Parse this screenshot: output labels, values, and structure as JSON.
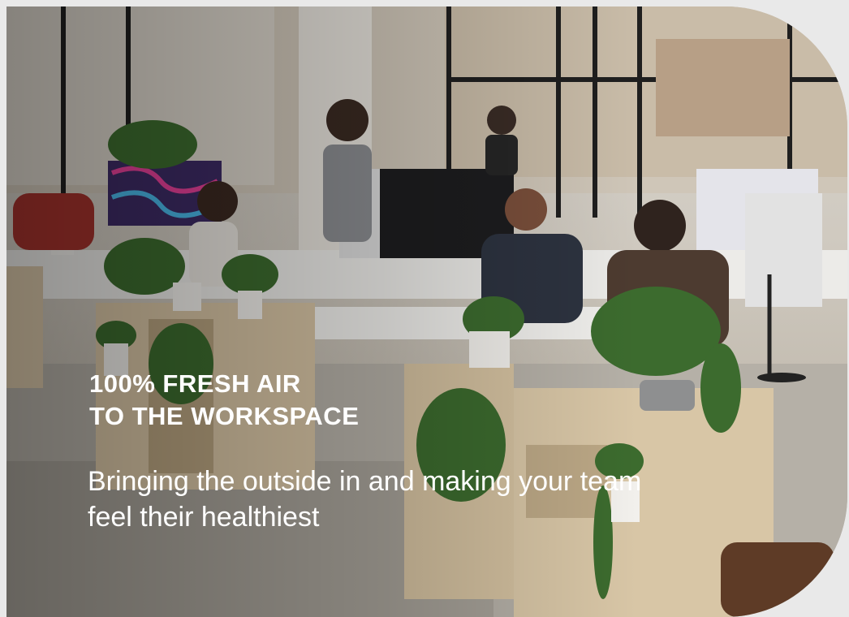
{
  "hero": {
    "image_description": "office-workspace-photo",
    "headline_line1": "100% FRESH AIR",
    "headline_line2": "TO THE WORKSPACE",
    "subtitle": "Bringing the outside in and making your team feel their healthiest"
  }
}
